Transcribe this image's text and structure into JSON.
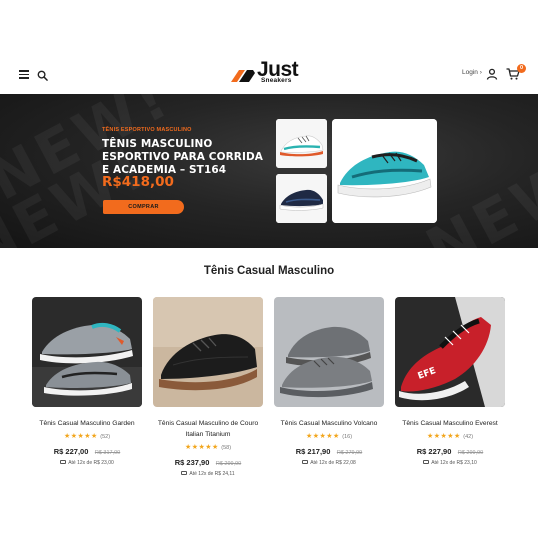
{
  "header": {
    "logo_word": "Just",
    "logo_sub": "Sneakers",
    "login_label": "Login",
    "cart_count": "0"
  },
  "hero": {
    "kicker": "TÊNIS ESPORTIVO MASCULINO",
    "title": "TÊNIS MASCULINO ESPORTIVO PARA CORRIDA E ACADEMIA – ST164",
    "price": "R$418,00",
    "button_label": "COMPRAR",
    "watermark": "NEW!"
  },
  "section": {
    "title": "Tênis Casual Masculino"
  },
  "products": [
    {
      "name": "Tênis Casual Masculino Garden",
      "stars": "★★★★★",
      "reviews": "(52)",
      "price": "R$ 227,00",
      "old_price": "R$ 317,00",
      "installments": "Até 12x de R$ 23,00"
    },
    {
      "name": "Tênis Casual Masculino de Couro Italian Titanium",
      "stars": "★★★★★",
      "reviews": "(58)",
      "price": "R$ 237,90",
      "old_price": "R$ 299,90",
      "installments": "Até 12x de R$ 24,11"
    },
    {
      "name": "Tênis Casual Masculino Volcano",
      "stars": "★★★★★",
      "reviews": "(16)",
      "price": "R$ 217,90",
      "old_price": "R$ 279,99",
      "installments": "Até 12x de R$ 22,08"
    },
    {
      "name": "Tênis Casual Masculino Everest",
      "stars": "★★★★★",
      "reviews": "(42)",
      "price": "R$ 227,90",
      "old_price": "R$ 299,90",
      "installments": "Até 12x de R$ 23,10"
    }
  ],
  "colors": {
    "accent": "#f26b1d",
    "hero_bg": "#1e1e1e",
    "star": "#f2a61d"
  },
  "icons": [
    "hamburger-menu-icon",
    "search-icon",
    "user-icon",
    "cart-icon",
    "credit-card-icon",
    "star-icon"
  ]
}
